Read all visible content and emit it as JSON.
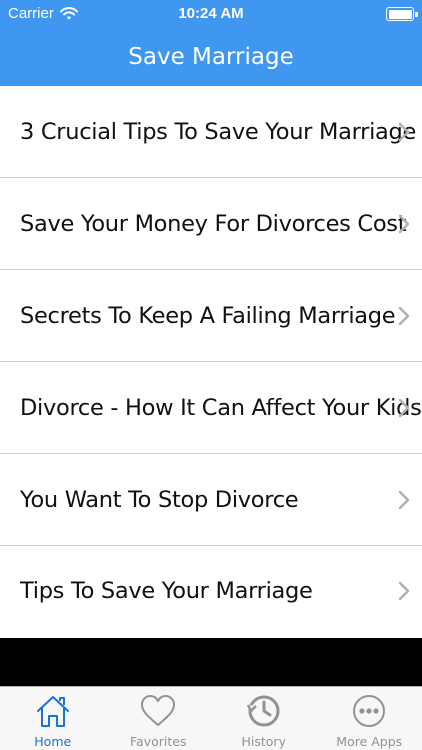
{
  "status_bar": {
    "carrier": "Carrier",
    "time": "10:24 AM",
    "battery_level": 1.0
  },
  "nav": {
    "title": "Save Marriage"
  },
  "list": {
    "items": [
      {
        "label": "3 Crucial Tips To Save Your Marriage"
      },
      {
        "label": "Save Your Money For Divorces Cost"
      },
      {
        "label": "Secrets To Keep A Failing Marriage"
      },
      {
        "label": "Divorce - How It Can Affect Your Kids"
      },
      {
        "label": "You Want To Stop Divorce"
      },
      {
        "label": "Tips To Save Your Marriage"
      }
    ]
  },
  "tabbar": {
    "items": [
      {
        "label": "Home",
        "icon": "home-icon",
        "active": true
      },
      {
        "label": "Favorites",
        "icon": "heart-icon",
        "active": false
      },
      {
        "label": "History",
        "icon": "history-icon",
        "active": false
      },
      {
        "label": "More Apps",
        "icon": "more-icon",
        "active": false
      }
    ]
  },
  "colors": {
    "header": "#3f97f0",
    "tab_active": "#1a73d9",
    "tab_inactive": "#929292",
    "ad_band": "#000000"
  }
}
